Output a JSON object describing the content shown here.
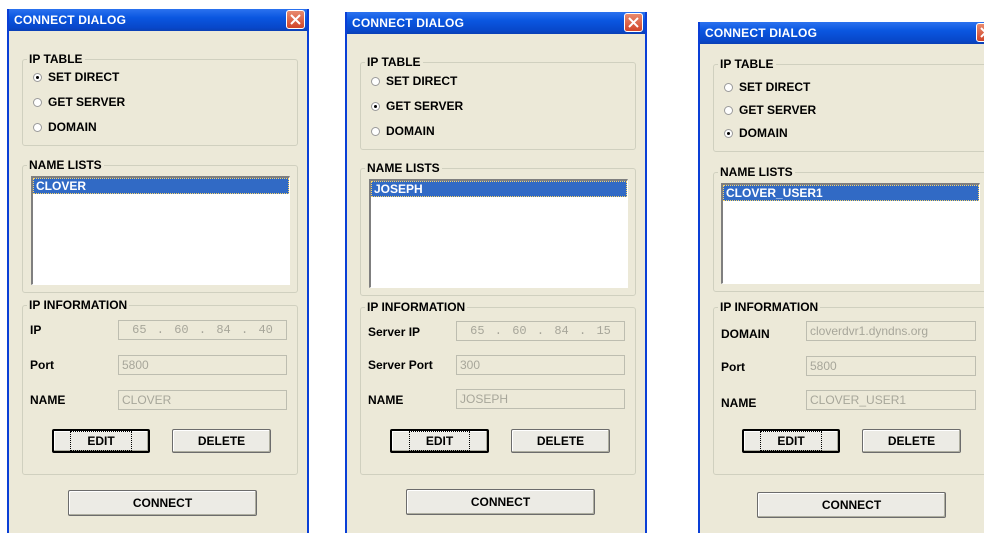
{
  "dialogs": [
    {
      "title": "CONNECT DIALOG",
      "ip_table": {
        "legend": "IP TABLE",
        "options": [
          "SET DIRECT",
          "GET SERVER",
          "DOMAIN"
        ],
        "selected": "SET DIRECT"
      },
      "name_lists": {
        "legend": "NAME LISTS",
        "selected_item": "CLOVER"
      },
      "ip_information": {
        "legend": "IP INFORMATION",
        "row1_label": "IP",
        "ip_octets": [
          "65",
          "60",
          "84",
          "40"
        ],
        "row2_label": "Port",
        "row2_value": "5800",
        "row3_label": "NAME",
        "row3_value": "CLOVER"
      },
      "edit_label": "EDIT",
      "delete_label": "DELETE",
      "connect_label": "CONNECT"
    },
    {
      "title": "CONNECT DIALOG",
      "ip_table": {
        "legend": "IP TABLE",
        "options": [
          "SET DIRECT",
          "GET SERVER",
          "DOMAIN"
        ],
        "selected": "GET SERVER"
      },
      "name_lists": {
        "legend": "NAME LISTS",
        "selected_item": "JOSEPH"
      },
      "ip_information": {
        "legend": "IP INFORMATION",
        "row1_label": "Server IP",
        "ip_octets": [
          "65",
          "60",
          "84",
          "15"
        ],
        "row2_label": "Server Port",
        "row2_value": "300",
        "row3_label": "NAME",
        "row3_value": "JOSEPH"
      },
      "edit_label": "EDIT",
      "delete_label": "DELETE",
      "connect_label": "CONNECT"
    },
    {
      "title": "CONNECT DIALOG",
      "ip_table": {
        "legend": "IP TABLE",
        "options": [
          "SET DIRECT",
          "GET SERVER",
          "DOMAIN"
        ],
        "selected": "DOMAIN"
      },
      "name_lists": {
        "legend": "NAME LISTS",
        "selected_item": "CLOVER_USER1"
      },
      "ip_information": {
        "legend": "IP INFORMATION",
        "row1_label": "DOMAIN",
        "row1_value": "cloverdvr1.dyndns.org",
        "row2_label": "Port",
        "row2_value": "5800",
        "row3_label": "NAME",
        "row3_value": "CLOVER_USER1"
      },
      "edit_label": "EDIT",
      "delete_label": "DELETE",
      "connect_label": "CONNECT"
    }
  ]
}
